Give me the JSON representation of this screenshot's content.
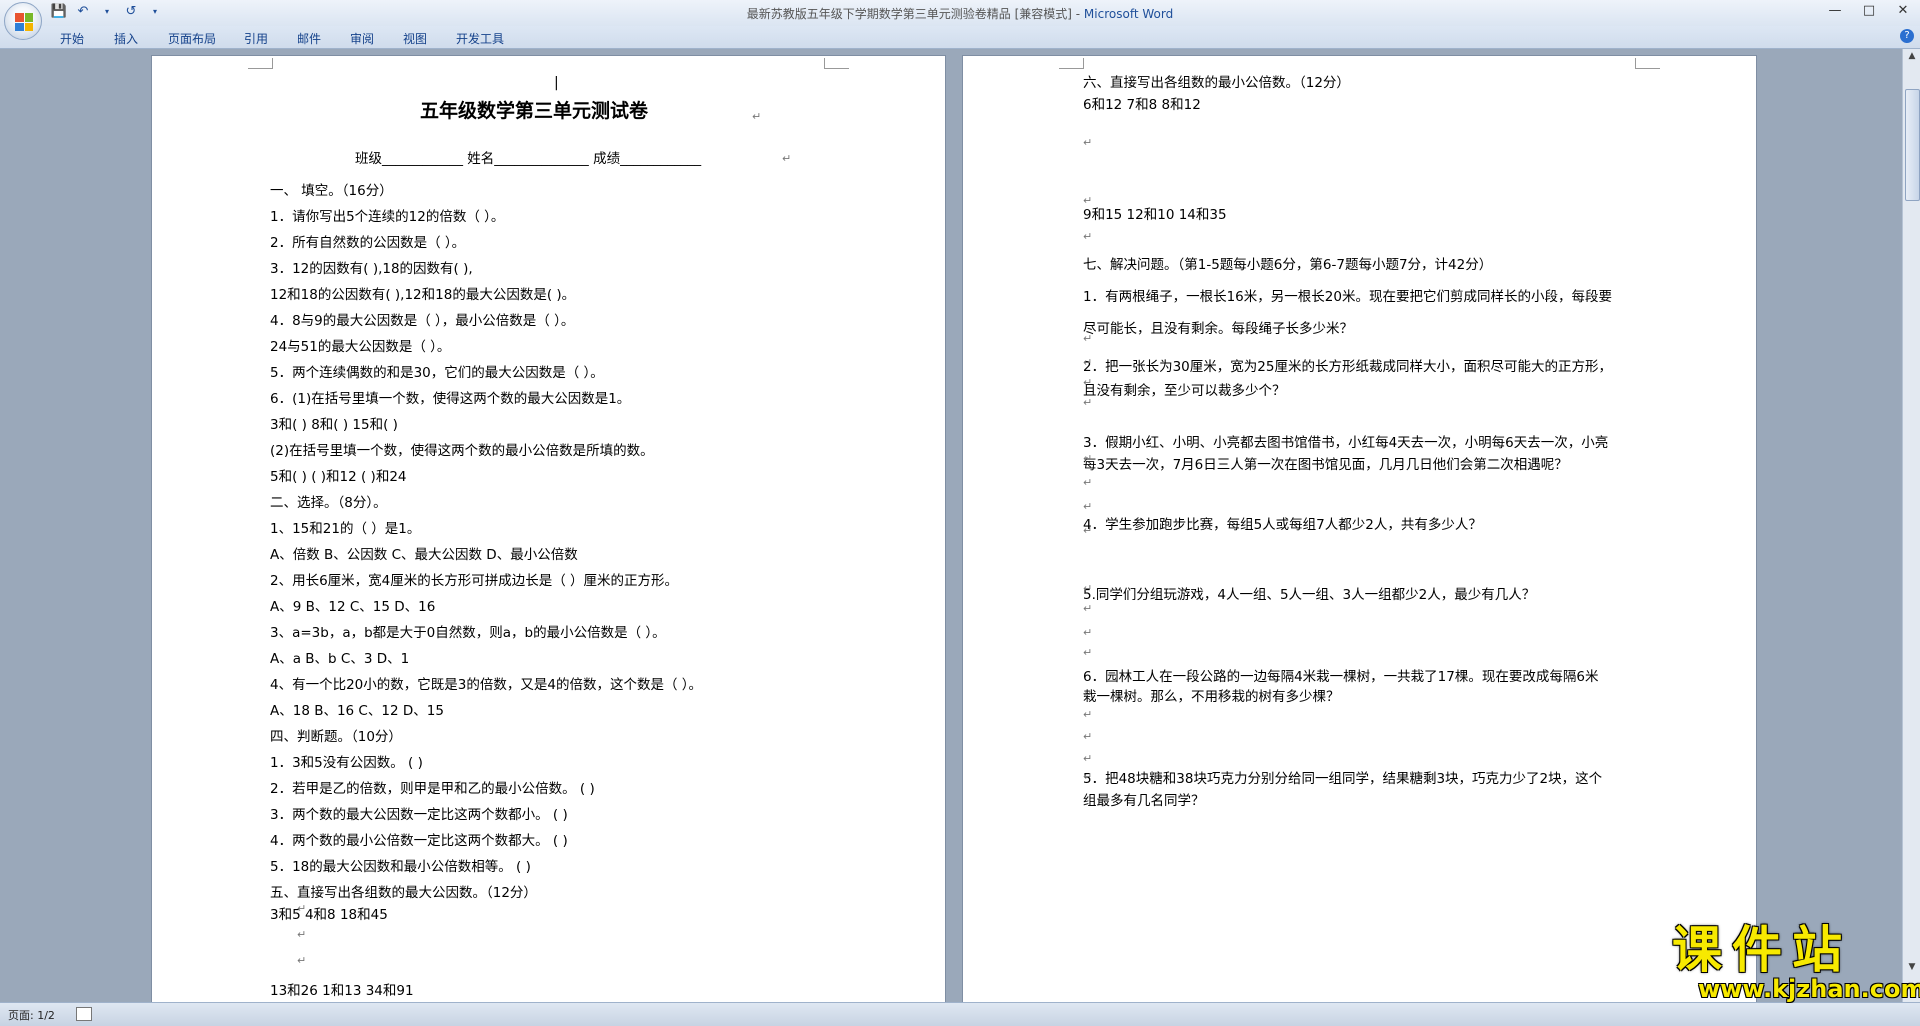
{
  "window": {
    "title": "最新苏教版五年级下学期数学第三单元测验卷精品 [兼容模式] - ",
    "app_name": "Microsoft Word"
  },
  "ribbon": {
    "tabs": [
      "开始",
      "插入",
      "页面布局",
      "引用",
      "邮件",
      "审阅",
      "视图",
      "开发工具"
    ]
  },
  "status": {
    "page": "页面: 1/2"
  },
  "watermark": {
    "text": "课件站",
    "url": "www.kjzhan.com"
  },
  "doc": {
    "title": "五年级数学第三单元测试卷",
    "info_line": "班级____________ 姓名______________ 成绩____________",
    "page1": [
      "一、      填空。（16分）",
      "1．请你写出5个连续的12的倍数（                              ）。",
      "2．所有自然数的公因数是（        ）。",
      "3．12的因数有(                       ),18的因数有(                          ),",
      "   12和18的公因数有(                        ),12和18的最大公因数是(        )。",
      "4．8与9的最大公因数是（          ），最小公倍数是（          ）。",
      "   24与51的最大公因数是（          ）。",
      "5．两个连续偶数的和是30，它们的最大公因数是（      ）。",
      "6．(1)在括号里填一个数，使得这两个数的最大公因数是1。",
      "      3和(      )            8和(      )            15和(       )",
      "   (2)在括号里填一个数，使得这两个数的最小公倍数是所填的数。",
      "      5和(        )         (      )和12       (      )和24",
      "二、选择。（8分）。",
      "1、15和21的（  ）是1。",
      "A、倍数            B、公因数           C、最大公因数         D、最小公倍数",
      "2、用长6厘米，宽4厘米的长方形可拼成边长是（      ）厘米的正方形。",
      "A、9              B、12             C、15             D、16",
      "3、a=3b，a，b都是大于0自然数，则a，b的最小公倍数是（      ）。",
      "A、a              B、b              C、3              D、1",
      "4、有一个比20小的数，它既是3的倍数，又是4的倍数，这个数是（     ）。",
      "A、18             B、16             C、12             D、15",
      "四、判断题。（10分）",
      "1．3和5没有公因数。                                    (         )",
      "2．若甲是乙的倍数，则甲是甲和乙的最小公倍数。   (         )",
      "3．两个数的最大公因数一定比这两个数都小。         (         )",
      "4．两个数的最小公倍数一定比这两个数都大。         (         )",
      "5．18的最大公因数和最小公倍数相等。                 (         )",
      "五、直接写出各组数的最大公因数。（12分）",
      "   3和5                     4和8                     18和45",
      "",
      "",
      "   13和26                   1和13                    34和91"
    ],
    "page2": [
      "六、直接写出各组数的最小公倍数。（12分）",
      "   6和12                     7和8                     8和12",
      "",
      "",
      "   9和15                     12和10                   14和35",
      "",
      "七、解决问题。（第1-5题每小题6分，第6-7题每小题7分，计42分）",
      "1．有两根绳子，一根长16米，另一根长20米。现在要把它们剪成同样长的小段，每段要",
      "尽可能长，且没有剩余。每段绳子长多少米？",
      "2．把一张长为30厘米，宽为25厘米的长方形纸裁成同样大小，面积尽可能大的正方形，",
      "且没有剩余，至少可以裁多少个？",
      "3．假期小红、小明、小亮都去图书馆借书，小红每4天去一次，小明每6天去一次，小亮",
      "每3天去一次，7月6日三人第一次在图书馆见面，几月几日他们会第二次相遇呢？",
      "4．学生参加跑步比赛，每组5人或每组7人都少2人，共有多少人？",
      "5.同学们分组玩游戏，4人一组、5人一组、3人一组都少2人，最少有几人？",
      "6．园林工人在一段公路的一边每隔4米栽一棵树，一共栽了17棵。现在要改成每隔6米",
      "   栽一棵树。那么，不用移栽的树有多少棵？",
      "5．把48块糖和38块巧克力分别分给同一组同学，结果糖剩3块，巧克力少了2块，这个",
      "组最多有几名同学？"
    ]
  }
}
